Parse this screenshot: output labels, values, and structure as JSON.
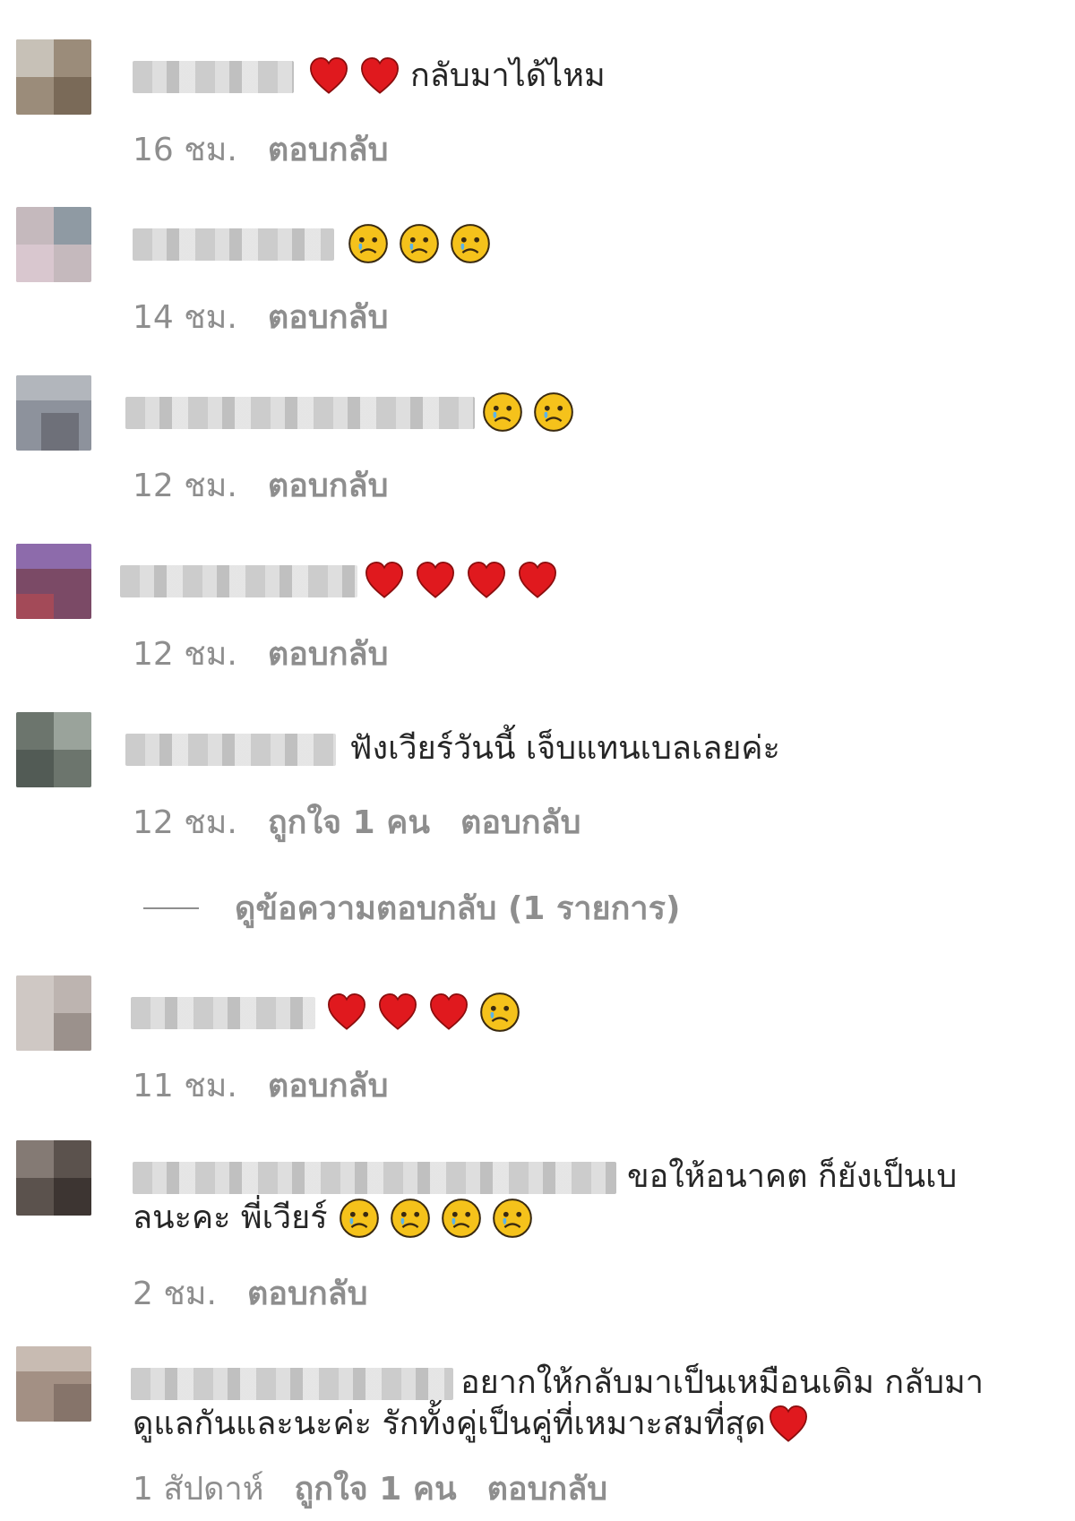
{
  "reply_label": "ตอบกลับ",
  "comments": [
    {
      "text": "กลับมาได้ไหม",
      "emojis_before": [
        "heart",
        "heart"
      ],
      "emojis_after": [],
      "time": "16 ชม.",
      "likes": ""
    },
    {
      "text": "",
      "emojis_before": [],
      "emojis_after": [
        "sad",
        "sad",
        "sad"
      ],
      "time": "14 ชม.",
      "likes": ""
    },
    {
      "text": "",
      "emojis_before": [],
      "emojis_after": [
        "sad",
        "sad"
      ],
      "time": "12 ชม.",
      "likes": ""
    },
    {
      "text": "",
      "emojis_before": [],
      "emojis_after": [
        "heart",
        "heart",
        "heart",
        "heart"
      ],
      "time": "12 ชม.",
      "likes": ""
    },
    {
      "text": "ฟังเวียร์วันนี้ เจ็บแทนเบลเลยค่ะ",
      "emojis_before": [],
      "emojis_after": [],
      "time": "12 ชม.",
      "likes": "ถูกใจ 1 คน",
      "view_replies": "ดูข้อความตอบกลับ (1 รายการ)"
    },
    {
      "text": "",
      "emojis_before": [],
      "emojis_after": [
        "heart",
        "heart",
        "heart",
        "sad"
      ],
      "time": "11 ชม.",
      "likes": ""
    },
    {
      "text_line1": "ขอให้อนาคต ก็ยังเป็นเบ",
      "text_line2": "ลนะคะ พี่เวียร์",
      "emojis_after": [
        "sad",
        "sad",
        "sad",
        "sad"
      ],
      "time": "2 ชม.",
      "likes": ""
    },
    {
      "text_line1": "อยากให้กลับมาเป็นเหมือนเดิม กลับมา",
      "text_line2": "ดูแลกันและนะค่ะ รักทั้งคู่เป็นคู่ที่เหมาะสมที่สุด",
      "emojis_after": [
        "heart"
      ],
      "time": "1 สัปดาห์",
      "likes": "ถูกใจ 1 คน"
    }
  ],
  "colors": {
    "meta": "#8e8e8e",
    "text": "#262626",
    "heart": "#e0191e",
    "sad_face": "#f5c21b"
  }
}
